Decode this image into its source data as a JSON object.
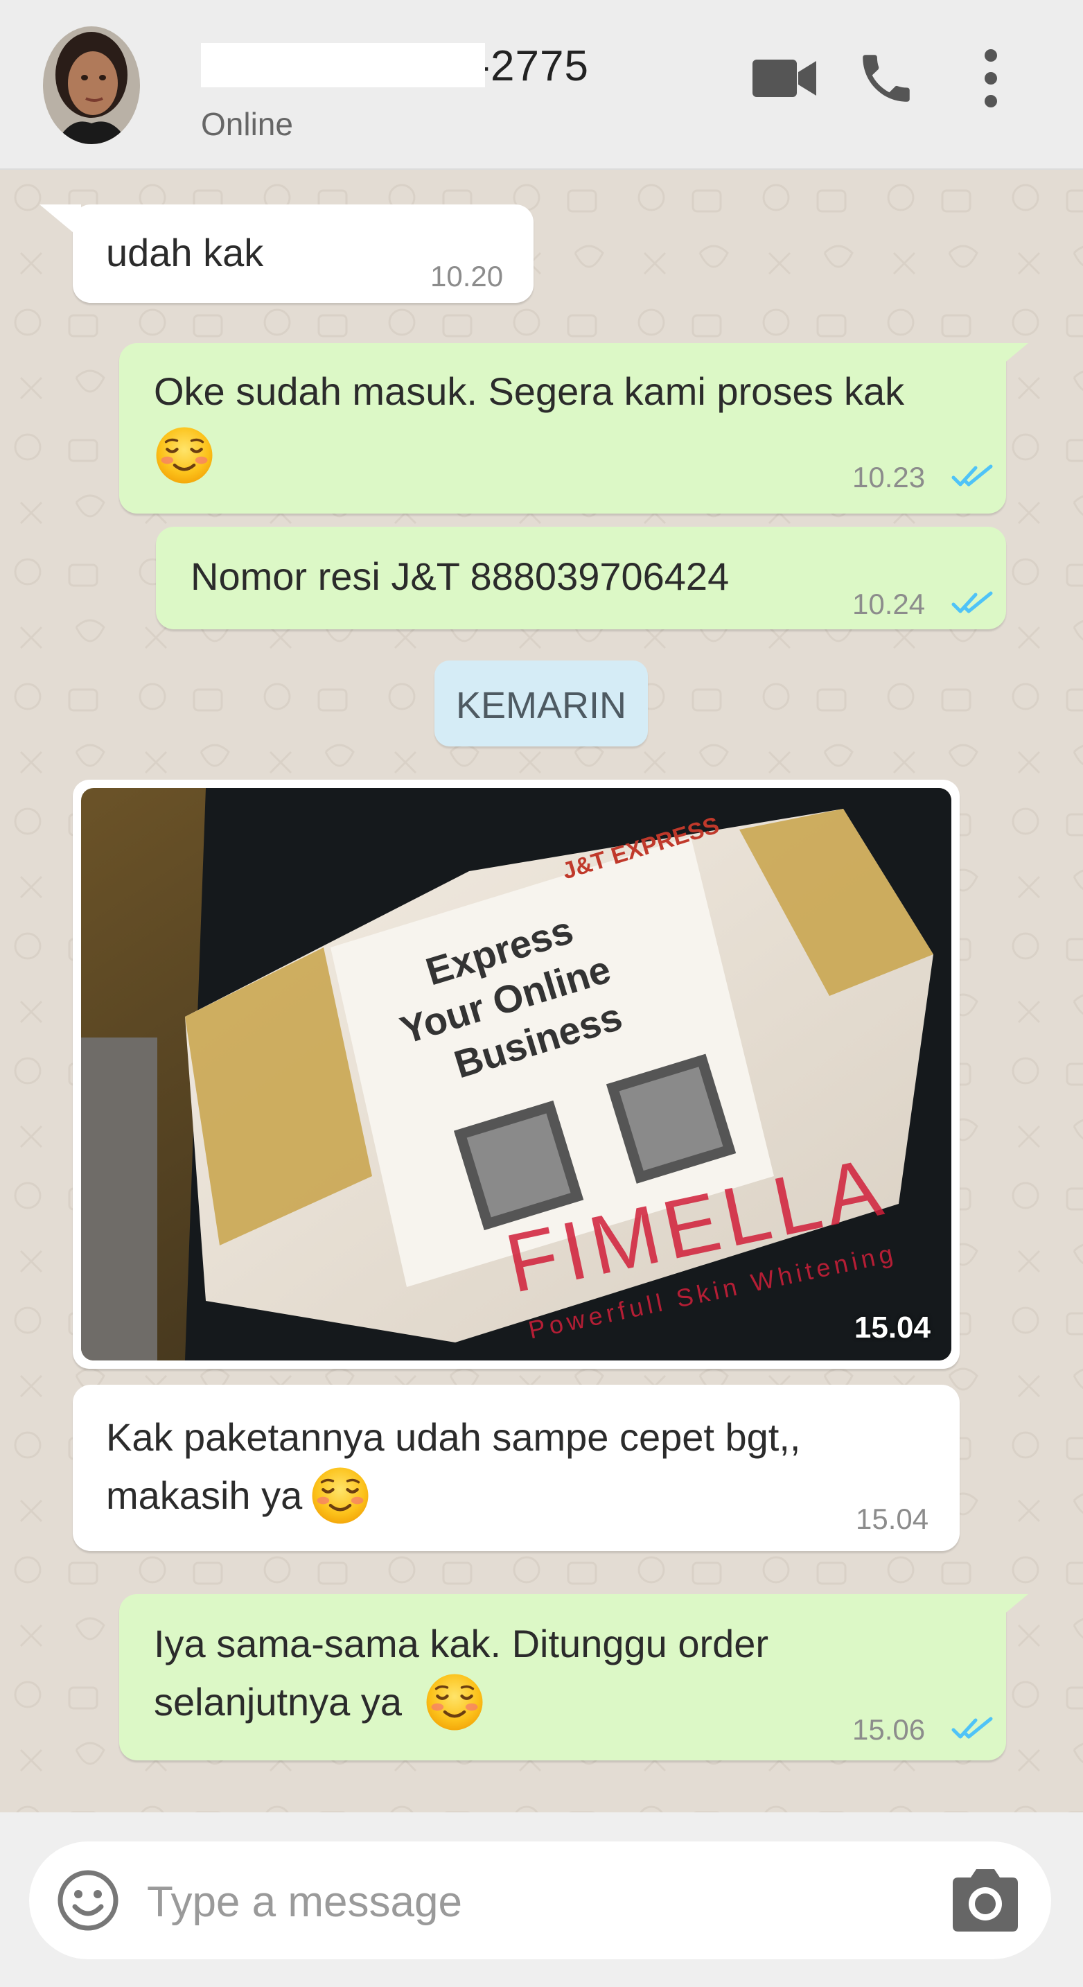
{
  "header": {
    "contact_name": "+62 878-0000-2775",
    "status": "Online"
  },
  "messages": [
    {
      "direction": "in",
      "text": "udah kak",
      "time": "10.20"
    },
    {
      "direction": "out",
      "text": "Oke sudah masuk. Segera kami proses kak",
      "emoji": "smiling-face-emoji",
      "time": "10.23",
      "status": "read"
    },
    {
      "direction": "out",
      "text": "Nomor resi J&T 888039706424",
      "time": "10.24",
      "status": "read"
    },
    {
      "type": "date_divider",
      "text": "KEMARIN"
    },
    {
      "direction": "in",
      "type": "image",
      "time": "15.04",
      "image_text": {
        "brand": "J&T EXPRESS",
        "slogan_1": "Express",
        "slogan_2": "Your Online",
        "slogan_3": "Business",
        "watermark_brand": "FIMELLA",
        "watermark_tagline": "Powerfull Skin Whitening"
      }
    },
    {
      "direction": "in",
      "text_line1": "Kak paketannya udah sampe cepet bgt,,",
      "text_line2": "makasih ya",
      "emoji": "smiling-face-emoji",
      "time": "15.04"
    },
    {
      "direction": "out",
      "text_line1": "Iya sama-sama kak. Ditunggu order",
      "text_line2": "selanjutnya ya",
      "emoji": "smiling-face-emoji",
      "time": "15.06",
      "status": "read"
    }
  ],
  "input": {
    "placeholder": "Type a message"
  },
  "icons": {
    "video": "video-call-icon",
    "phone": "voice-call-icon",
    "menu": "more-vert-icon",
    "emoji": "emoji-icon",
    "camera": "camera-icon"
  },
  "colors": {
    "outgoing_bubble": "#dcf8c6",
    "incoming_bubble": "#ffffff",
    "header": "#ededed",
    "chat_bg": "#e3dcd3",
    "read_ticks": "#4fc3f7"
  }
}
